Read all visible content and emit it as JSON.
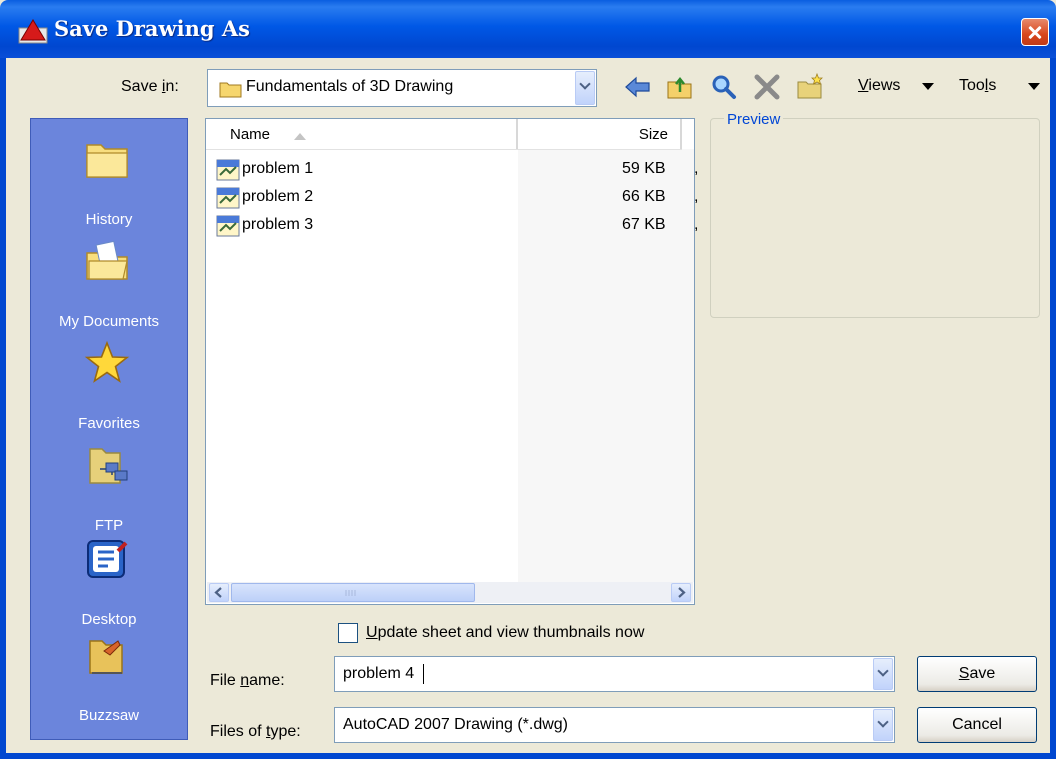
{
  "window": {
    "title": "Save Drawing As"
  },
  "save_in": {
    "label_pre": "Save ",
    "label_key": "i",
    "label_post": "n:",
    "value": "Fundamentals of 3D Drawing"
  },
  "toolbar": {
    "icons": [
      "back-icon",
      "up-folder-icon",
      "search-web-icon",
      "delete-icon",
      "create-folder-icon"
    ],
    "views_key": "V",
    "views_rest": "iews",
    "tools_pre": "Too",
    "tools_key": "l",
    "tools_post": "s"
  },
  "places": [
    {
      "label": "History",
      "icon": "history-folder-icon"
    },
    {
      "label": "My Documents",
      "icon": "my-documents-icon"
    },
    {
      "label": "Favorites",
      "icon": "favorites-star-icon"
    },
    {
      "label": "FTP",
      "icon": "ftp-icon"
    },
    {
      "label": "Desktop",
      "icon": "desktop-icon"
    },
    {
      "label": "Buzzsaw",
      "icon": "buzzsaw-icon"
    }
  ],
  "file_list": {
    "columns": {
      "name": "Name",
      "size": "Size"
    },
    "rows": [
      {
        "name": "problem 1",
        "size": "59 KB",
        "extra": ","
      },
      {
        "name": "problem 2",
        "size": "66 KB",
        "extra": ","
      },
      {
        "name": "problem 3",
        "size": "67 KB",
        "extra": ","
      }
    ]
  },
  "preview": {
    "label": "Preview"
  },
  "thumbnails": {
    "label_key": "U",
    "label_rest": "pdate sheet and view thumbnails now",
    "checked": false
  },
  "file_name": {
    "label_pre": "File ",
    "label_key": "n",
    "label_post": "ame:",
    "value": "problem 4"
  },
  "file_type": {
    "label_pre": "Files of ",
    "label_key": "t",
    "label_post": "ype:",
    "value": "AutoCAD 2007 Drawing (*.dwg)"
  },
  "buttons": {
    "save_key": "S",
    "save_rest": "ave",
    "cancel": "Cancel"
  },
  "colors": {
    "title_bar": "#0058e6",
    "places_bar": "#6b85dc",
    "preview_label": "#0046d5"
  }
}
